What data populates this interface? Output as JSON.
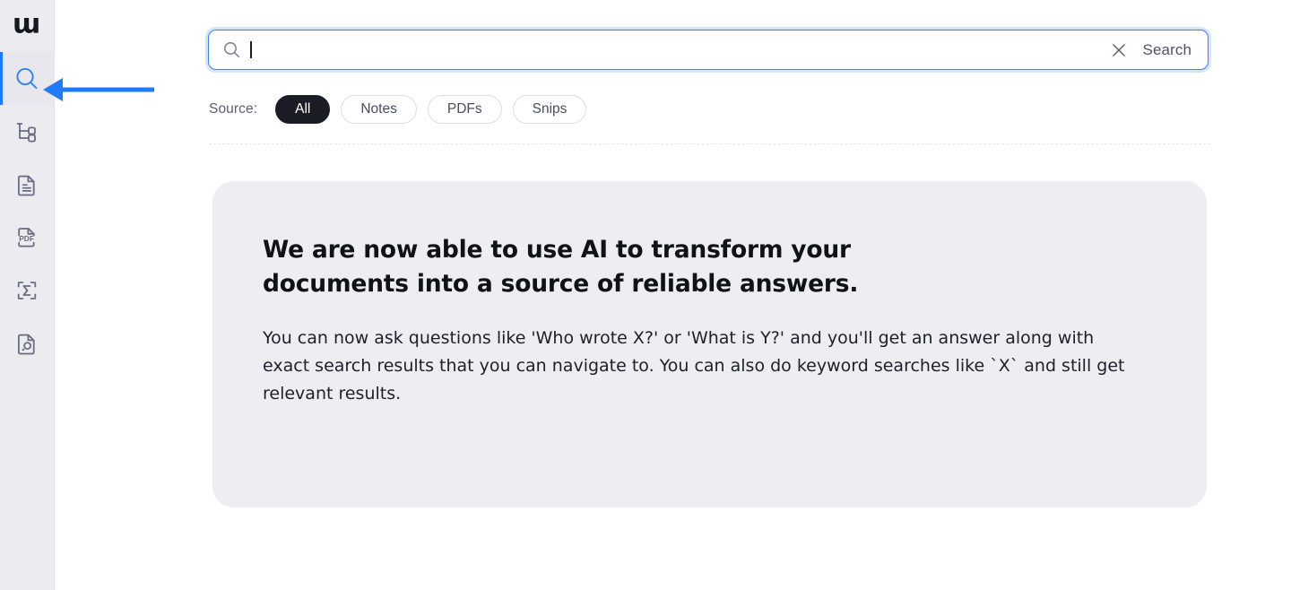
{
  "app": {
    "logo_glyph": "m",
    "logo_name": "app-logo"
  },
  "sidebar": {
    "items": [
      {
        "label": "Search",
        "icon": "search-icon",
        "active": true
      },
      {
        "label": "Workspace Tree",
        "icon": "tree-hierarchy-icon",
        "active": false
      },
      {
        "label": "Notes",
        "icon": "document-text-icon",
        "active": false
      },
      {
        "label": "PDFs",
        "icon": "pdf-file-icon",
        "active": false
      },
      {
        "label": "Formulas",
        "icon": "sigma-scan-icon",
        "active": false
      },
      {
        "label": "Snips",
        "icon": "document-snip-icon",
        "active": false
      }
    ]
  },
  "search": {
    "value": "",
    "placeholder": "",
    "icon": "search-icon",
    "clear_icon": "close-x-icon",
    "submit_label": "Search"
  },
  "filters": {
    "label": "Source:",
    "options": [
      {
        "label": "All",
        "selected": true
      },
      {
        "label": "Notes",
        "selected": false
      },
      {
        "label": "PDFs",
        "selected": false
      },
      {
        "label": "Snips",
        "selected": false
      }
    ]
  },
  "announcement": {
    "title": "We are now able to use AI to transform your documents into a source of reliable answers.",
    "body": "You can now ask questions like 'Who wrote X?' or 'What is Y?' and you'll get an answer along with exact search results that you can navigate to. You can also do keyword searches like `X` and still get relevant results."
  },
  "annotation": {
    "type": "arrow-left",
    "target": "sidebar-item-search",
    "color": "#1f7aff"
  },
  "colors": {
    "accent_blue": "#1f7aff",
    "sidebar_bg": "#ecebf0",
    "card_bg": "#eeedf2",
    "pill_selected_bg": "#1c1c26",
    "icon_stroke": "#6b6b84"
  }
}
